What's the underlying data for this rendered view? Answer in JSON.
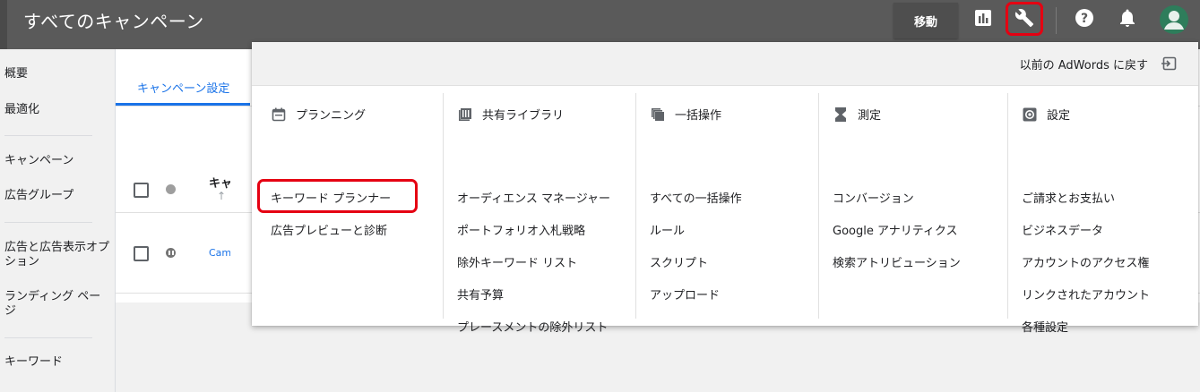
{
  "header": {
    "title": "すべてのキャンペーン",
    "move_button": "移動",
    "icons": [
      "reports-icon",
      "tools-icon",
      "help-icon",
      "notifications-icon",
      "account-avatar-icon"
    ]
  },
  "sidebar": {
    "items": [
      "概要",
      "最適化",
      "キャンペーン",
      "広告グループ",
      "広告と広告表示オプション",
      "ランディング ページ",
      "キーワード"
    ]
  },
  "main": {
    "tab": "キャンペーン設定",
    "column_header": "キャンペ",
    "sort_arrow": "↑",
    "row_campaign": "Campaign"
  },
  "panel": {
    "previous_adwords": "以前の AdWords に戻す",
    "columns": [
      {
        "title": "プランニング",
        "icon": "calendar-icon",
        "links": [
          "キーワード プランナー",
          "広告プレビューと診断"
        ]
      },
      {
        "title": "共有ライブラリ",
        "icon": "library-icon",
        "links": [
          "オーディエンス マネージャー",
          "ポートフォリオ入札戦略",
          "除外キーワード リスト",
          "共有予算",
          "プレースメントの除外リスト"
        ]
      },
      {
        "title": "一括操作",
        "icon": "copy-stack-icon",
        "links": [
          "すべての一括操作",
          "ルール",
          "スクリプト",
          "アップロード"
        ]
      },
      {
        "title": "測定",
        "icon": "hourglass-icon",
        "links": [
          "コンバージョン",
          "Google アナリティクス",
          "検索アトリビューション"
        ]
      },
      {
        "title": "設定",
        "icon": "settings-gear-icon",
        "links": [
          "ご請求とお支払い",
          "ビジネスデータ",
          "アカウントのアクセス権",
          "リンクされたアカウント",
          "各種設定"
        ]
      }
    ]
  },
  "colors": {
    "header_bg": "#5a5a5a",
    "accent_blue": "#1a73e8",
    "highlight_red": "#e50012"
  }
}
